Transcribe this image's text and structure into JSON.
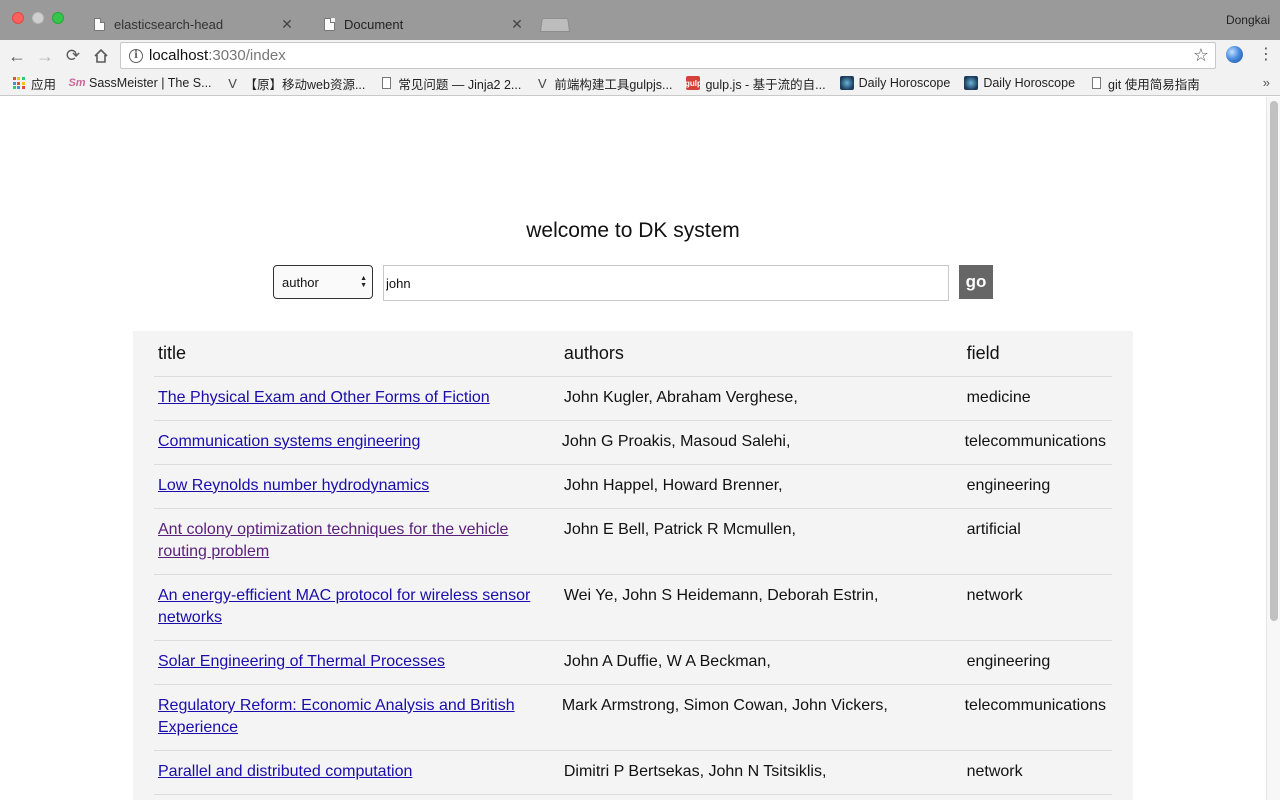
{
  "browser": {
    "tabs": [
      {
        "title": "elasticsearch-head",
        "active": false
      },
      {
        "title": "Document",
        "active": true
      }
    ],
    "profile_name": "Dongkai",
    "url": {
      "host": "localhost",
      "rest": ":3030/index"
    },
    "bookmarks": [
      {
        "label": "应用",
        "icon": "apps-icon"
      },
      {
        "label": "SassMeister | The S...",
        "icon": "sassmeister-icon"
      },
      {
        "label": "【原】移动web资源...",
        "icon": "v-icon"
      },
      {
        "label": "常见问题 — Jinja2 2...",
        "icon": "page-icon"
      },
      {
        "label": "前端构建工具gulpjs...",
        "icon": "v-icon"
      },
      {
        "label": "gulp.js - 基于流的自...",
        "icon": "gulp-icon"
      },
      {
        "label": "Daily Horoscope",
        "icon": "horoscope-icon"
      },
      {
        "label": "Daily Horoscope",
        "icon": "horoscope-icon"
      },
      {
        "label": "git 使用简易指南",
        "icon": "page-icon"
      }
    ]
  },
  "page": {
    "welcome": "welcome to DK system",
    "search": {
      "select_value": "author",
      "query": "john",
      "go_label": "go"
    },
    "table": {
      "headers": {
        "title": "title",
        "authors": "authors",
        "field": "field"
      },
      "rows": [
        {
          "title": "The Physical Exam and Other Forms of Fiction",
          "authors": "John Kugler, Abraham Verghese,",
          "field": "medicine",
          "visited": false
        },
        {
          "title": "Communication systems engineering",
          "authors": "John G Proakis, Masoud Salehi,",
          "field": "telecommunications",
          "visited": false
        },
        {
          "title": "Low Reynolds number hydrodynamics",
          "authors": "John Happel, Howard Brenner,",
          "field": "engineering",
          "visited": false
        },
        {
          "title": "Ant colony optimization techniques for the vehicle routing problem",
          "authors": "John E Bell, Patrick R Mcmullen,",
          "field": "artificial",
          "visited": true
        },
        {
          "title": "An energy-efficient MAC protocol for wireless sensor networks",
          "authors": "Wei Ye, John S Heidemann, Deborah Estrin,",
          "field": "network",
          "visited": false
        },
        {
          "title": "Solar Engineering of Thermal Processes",
          "authors": "John A Duffie, W A Beckman,",
          "field": "engineering",
          "visited": false
        },
        {
          "title": "Regulatory Reform: Economic Analysis and British Experience",
          "authors": "Mark Armstrong, Simon Cowan, John Vickers,",
          "field": "telecommunications",
          "visited": false
        },
        {
          "title": "Parallel and distributed computation",
          "authors": "Dimitri P Bertsekas, John N Tsitsiklis,",
          "field": "network",
          "visited": false
        }
      ]
    }
  }
}
